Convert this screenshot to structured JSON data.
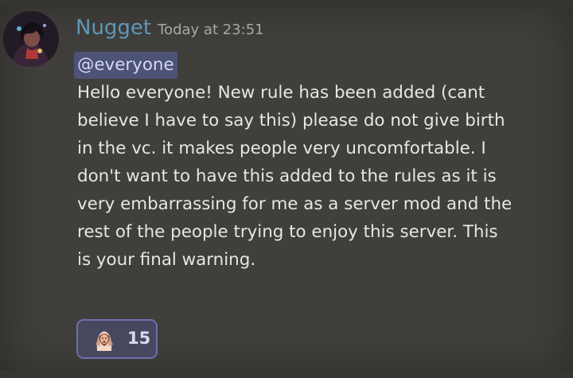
{
  "message": {
    "author": "Nugget",
    "timestamp": "Today at 23:51",
    "mention": "@everyone",
    "lines": [
      "Hello everyone! New rule has been added (cant",
      "believe I have to say this) please do not give birth",
      "in the vc. it makes people very uncomfortable. I",
      "don't want to have this added to the rules as it is",
      "very embarrassing for me as a server mod and the",
      "rest of the people trying to enjoy this server. This",
      "is your final warning."
    ],
    "reaction": {
      "emoji": "face-with-raised-hands-emoji",
      "count": "15"
    }
  },
  "colors": {
    "background": "#403f3c",
    "username": "#5f97b6",
    "timestamp": "#a7a8a2",
    "text": "#e7e7e0",
    "mention_bg": "#4d5277",
    "reaction_border": "#6d6fb0"
  }
}
